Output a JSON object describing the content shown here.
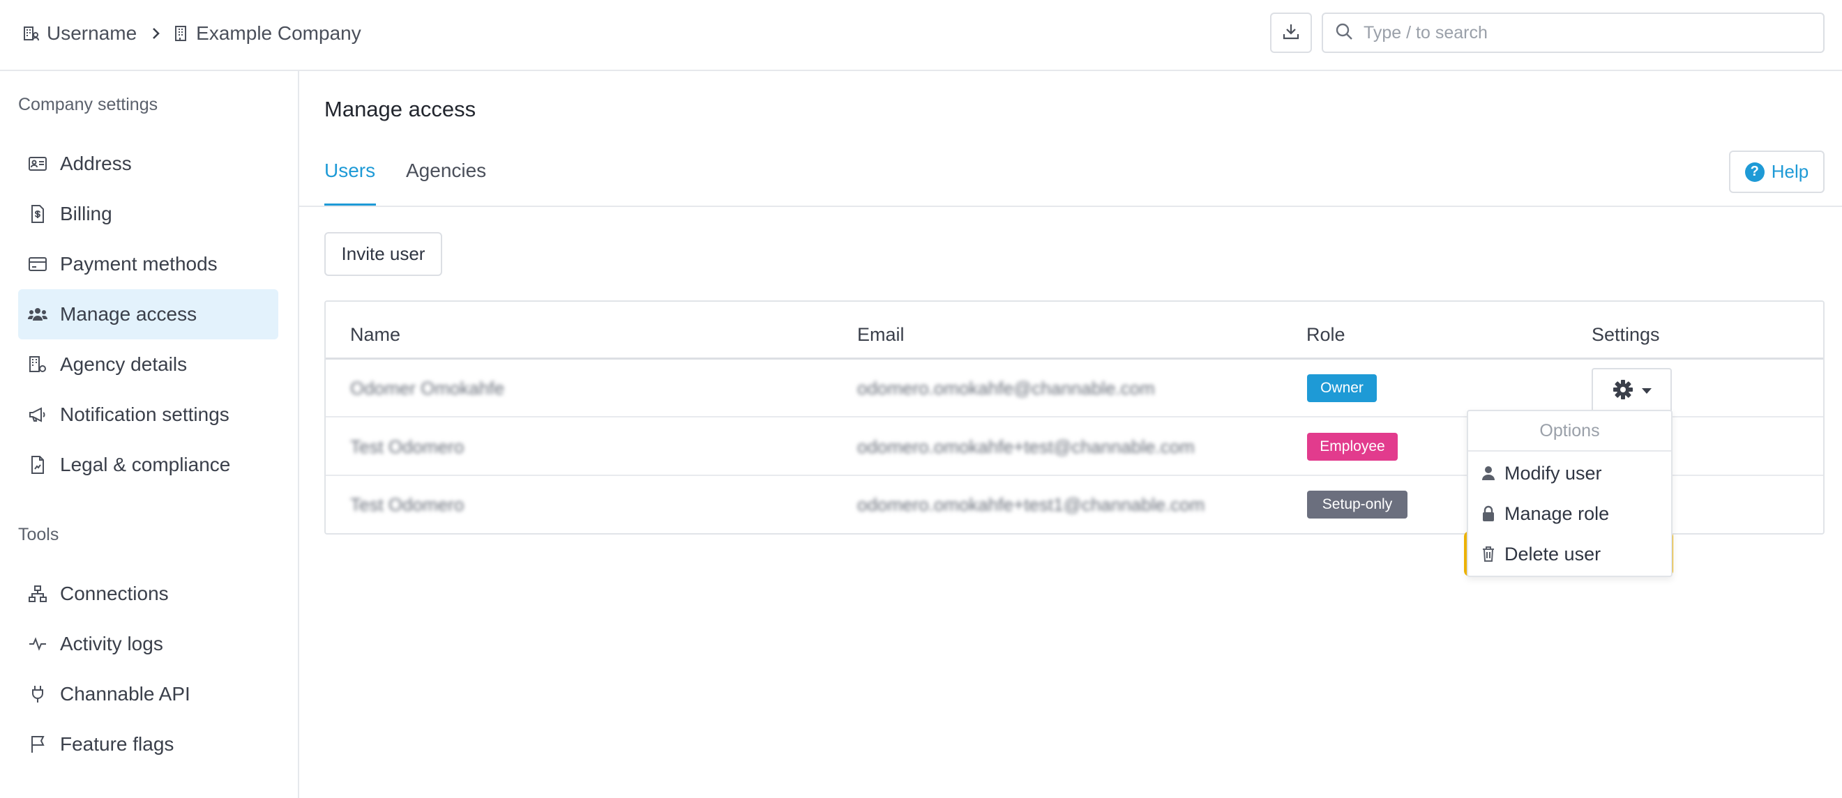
{
  "breadcrumb": {
    "user": "Username",
    "company": "Example Company"
  },
  "search": {
    "placeholder": "Type / to search"
  },
  "sidebar": {
    "sections": [
      {
        "heading": "Company settings",
        "items": [
          {
            "label": "Address",
            "icon": "address-card-icon"
          },
          {
            "label": "Billing",
            "icon": "invoice-icon"
          },
          {
            "label": "Payment methods",
            "icon": "credit-card-icon"
          },
          {
            "label": "Manage access",
            "icon": "users-icon",
            "active": true
          },
          {
            "label": "Agency details",
            "icon": "building-gear-icon"
          },
          {
            "label": "Notification settings",
            "icon": "megaphone-icon"
          },
          {
            "label": "Legal & compliance",
            "icon": "document-icon"
          }
        ]
      },
      {
        "heading": "Tools",
        "items": [
          {
            "label": "Connections",
            "icon": "network-icon"
          },
          {
            "label": "Activity logs",
            "icon": "pulse-icon"
          },
          {
            "label": "Channable API",
            "icon": "plug-icon"
          },
          {
            "label": "Feature flags",
            "icon": "flag-icon"
          }
        ]
      }
    ]
  },
  "main": {
    "title": "Manage access",
    "tabs": [
      {
        "label": "Users",
        "active": true
      },
      {
        "label": "Agencies"
      }
    ],
    "help_label": "Help",
    "invite_label": "Invite user",
    "table": {
      "headers": {
        "name": "Name",
        "email": "Email",
        "role": "Role",
        "settings": "Settings"
      },
      "rows": [
        {
          "name": "Odomer Omokahfe",
          "email": "odomero.omokahfe@channable.com",
          "role": "Owner"
        },
        {
          "name": "Test Odomero",
          "email": "odomero.omokahfe+test@channable.com",
          "role": "Employee"
        },
        {
          "name": "Test Odomero",
          "email": "odomero.omokahfe+test1@channable.com",
          "role": "Setup-only"
        }
      ]
    },
    "dropdown": {
      "header": "Options",
      "items": [
        {
          "label": "Modify user"
        },
        {
          "label": "Manage role"
        },
        {
          "label": "Delete user"
        }
      ]
    }
  },
  "colors": {
    "accent": "#1e9ad6",
    "owner_badge": "#1e9ad6",
    "employee_badge": "#e23b8d",
    "setup_badge": "#6b6f7e",
    "highlight": "#f2b705",
    "active_nav_bg": "#e3f2fc"
  }
}
